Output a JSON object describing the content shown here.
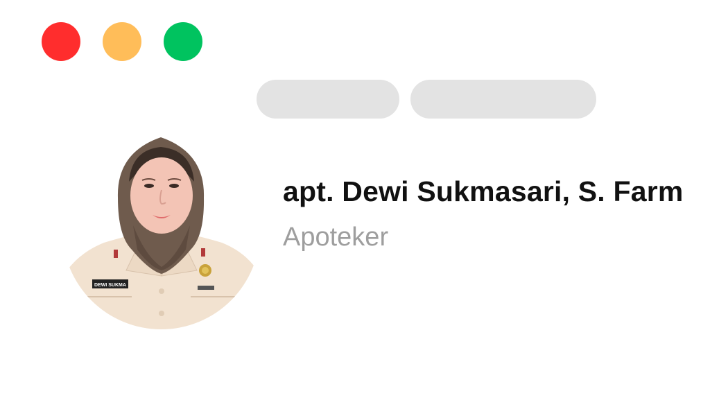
{
  "window": {
    "controls": [
      {
        "name": "close",
        "color": "#ff2d2d"
      },
      {
        "name": "minimize",
        "color": "#ffbd59"
      },
      {
        "name": "maximize",
        "color": "#00c35f"
      }
    ]
  },
  "profile": {
    "name": "apt. Dewi Sukmasari, S. Farm",
    "role": "Apoteker",
    "role_color": "#9e9e9e",
    "photo": {
      "icon": "profile-photo",
      "name_tag_text": "DEWI SUKMA",
      "uniform_color": "#f2e2d0",
      "hijab_color": "#6f5b4d"
    }
  }
}
